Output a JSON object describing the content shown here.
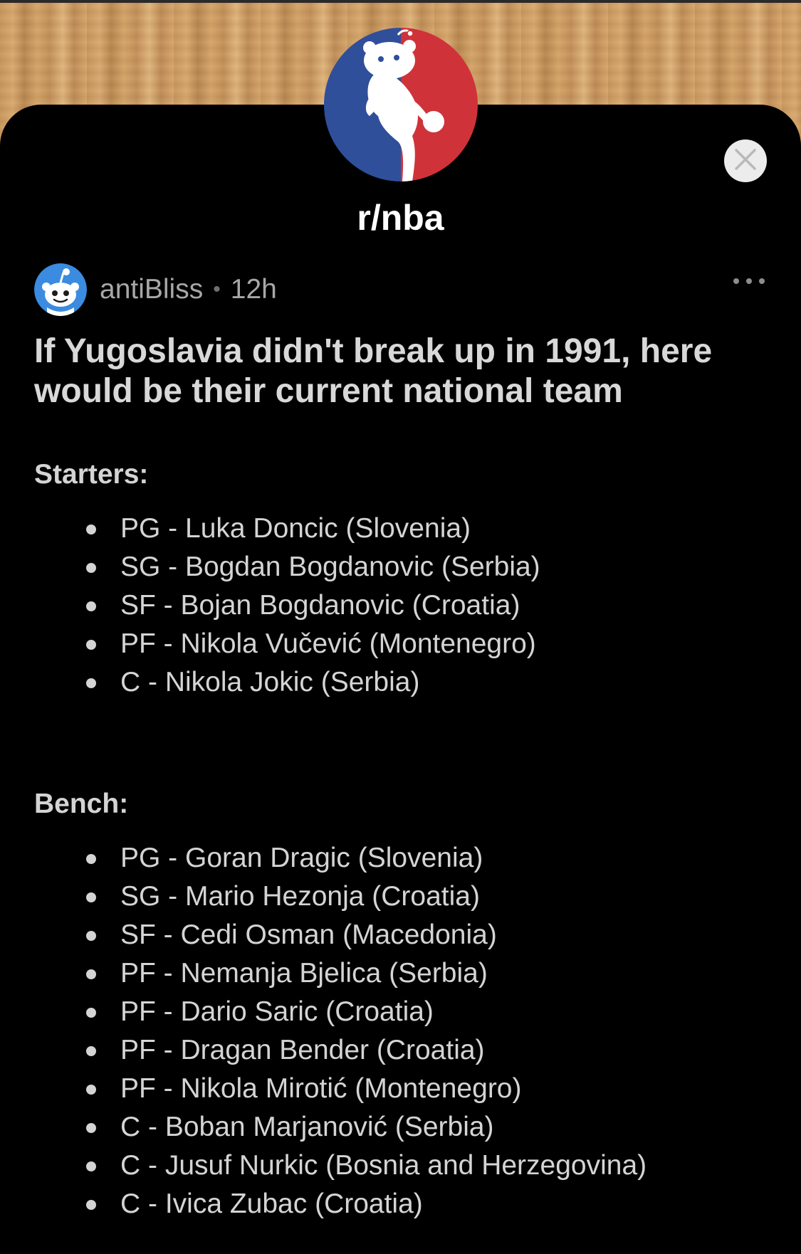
{
  "subreddit": {
    "name": "r/nba",
    "icon": "nba-logo-snoo-icon"
  },
  "post": {
    "author": "antiBliss",
    "separator": "•",
    "age": "12h",
    "title": "If Yugoslavia didn't break up in 1991, here would be their current national team",
    "sections": [
      {
        "heading": "Starters:",
        "players": [
          "PG - Luka Doncic (Slovenia)",
          "SG - Bogdan Bogdanovic (Serbia)",
          "SF - Bojan Bogdanovic (Croatia)",
          "PF - Nikola Vučević (Montenegro)",
          "C - Nikola Jokic (Serbia)"
        ]
      },
      {
        "heading": "Bench:",
        "players": [
          "PG - Goran Dragic (Slovenia)",
          "SG - Mario Hezonja (Croatia)",
          "SF - Cedi Osman (Macedonia)",
          "PF - Nemanja Bjelica (Serbia)",
          "PF - Dario Saric (Croatia)",
          "PF - Dragan Bender (Croatia)",
          "PF - Nikola Mirotić (Montenegro)",
          "C - Boban Marjanović (Serbia)",
          "C - Jusuf Nurkic (Bosnia and Herzegovina)",
          "C - Ivica Zubac (Croatia)"
        ]
      }
    ]
  },
  "icons": {
    "close": "close-icon",
    "more": "more-options-icon",
    "user": "user-avatar-snoo-icon"
  },
  "colors": {
    "logo_blue": "#2f4f9a",
    "logo_red": "#cf3339",
    "avatar_blue": "#3b8be0"
  }
}
